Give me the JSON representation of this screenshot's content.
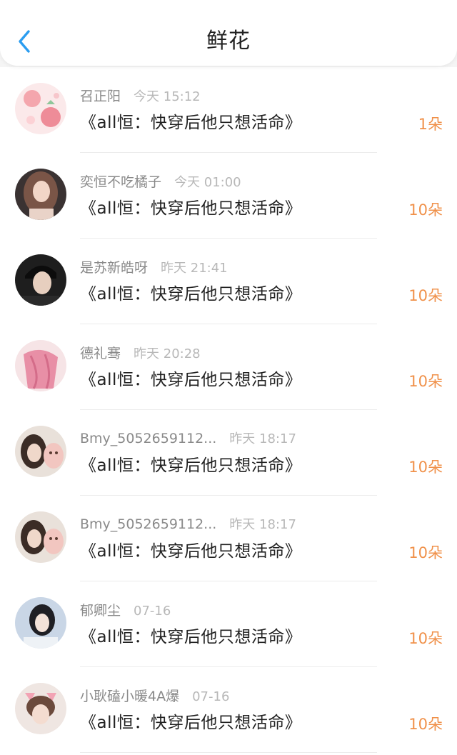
{
  "header": {
    "title": "鲜花",
    "back_icon": "chevron-left-icon",
    "accent": "#2b9df0"
  },
  "colors": {
    "count": "#f0914a",
    "name": "#8a8a8a",
    "time": "#b8b8b8"
  },
  "gifts": [
    {
      "name": "召正阳",
      "time": "今天 15:12",
      "book": "《all恒：快穿后他只想活命》",
      "count": "1朵"
    },
    {
      "name": "奕恒不吃橘子",
      "time": "今天 01:00",
      "book": "《all恒：快穿后他只想活命》",
      "count": "10朵"
    },
    {
      "name": "是苏新皓呀",
      "time": "昨天 21:41",
      "book": "《all恒：快穿后他只想活命》",
      "count": "10朵"
    },
    {
      "name": "德礼骞",
      "time": "昨天 20:28",
      "book": "《all恒：快穿后他只想活命》",
      "count": "10朵"
    },
    {
      "name": "Bmy_5052659112...",
      "time": "昨天 18:17",
      "book": "《all恒：快穿后他只想活命》",
      "count": "10朵"
    },
    {
      "name": "Bmy_5052659112...",
      "time": "昨天 18:17",
      "book": "《all恒：快穿后他只想活命》",
      "count": "10朵"
    },
    {
      "name": "郁卿尘",
      "time": "07-16",
      "book": "《all恒：快穿后他只想活命》",
      "count": "10朵"
    },
    {
      "name": "小耿磕小暖4A爆",
      "time": "07-16",
      "book": "《all恒：快穿后他只想活命》",
      "count": "10朵"
    }
  ]
}
